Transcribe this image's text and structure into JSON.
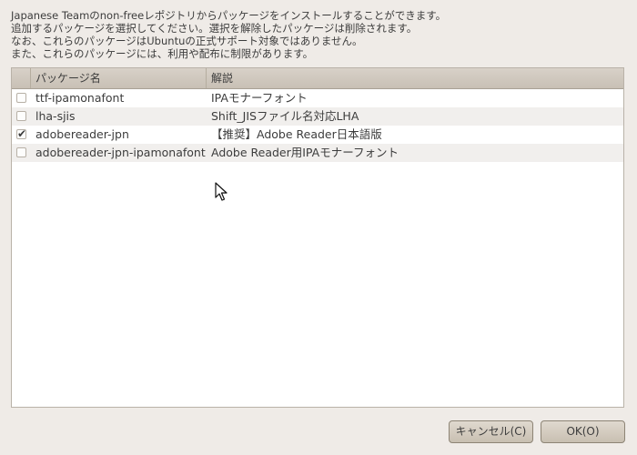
{
  "description": {
    "lines": [
      "Japanese Teamのnon-freeレポジトリからパッケージをインストールすることができます。",
      "追加するパッケージを選択してください。選択を解除したパッケージは削除されます。",
      "なお、これらのパッケージはUbuntuの正式サポート対象ではありません。",
      "また、これらのパッケージには、利用や配布に制限があります。"
    ]
  },
  "table": {
    "columns": {
      "name": "パッケージ名",
      "desc": "解説"
    },
    "rows": [
      {
        "checked": false,
        "name": "ttf-ipamonafont",
        "desc": "IPAモナーフォント"
      },
      {
        "checked": false,
        "name": "lha-sjis",
        "desc": "Shift_JISファイル名対応LHA"
      },
      {
        "checked": true,
        "name": "adobereader-jpn",
        "desc": "【推奨】Adobe Reader日本語版"
      },
      {
        "checked": false,
        "name": "adobereader-jpn-ipamonafont",
        "desc": "Adobe Reader用IPAモナーフォント"
      }
    ],
    "checkmark": "✔"
  },
  "buttons": {
    "cancel": "キャンセル(C)",
    "ok": "OK(O)"
  },
  "icons": {
    "cursor": "pointer-cursor-icon"
  }
}
